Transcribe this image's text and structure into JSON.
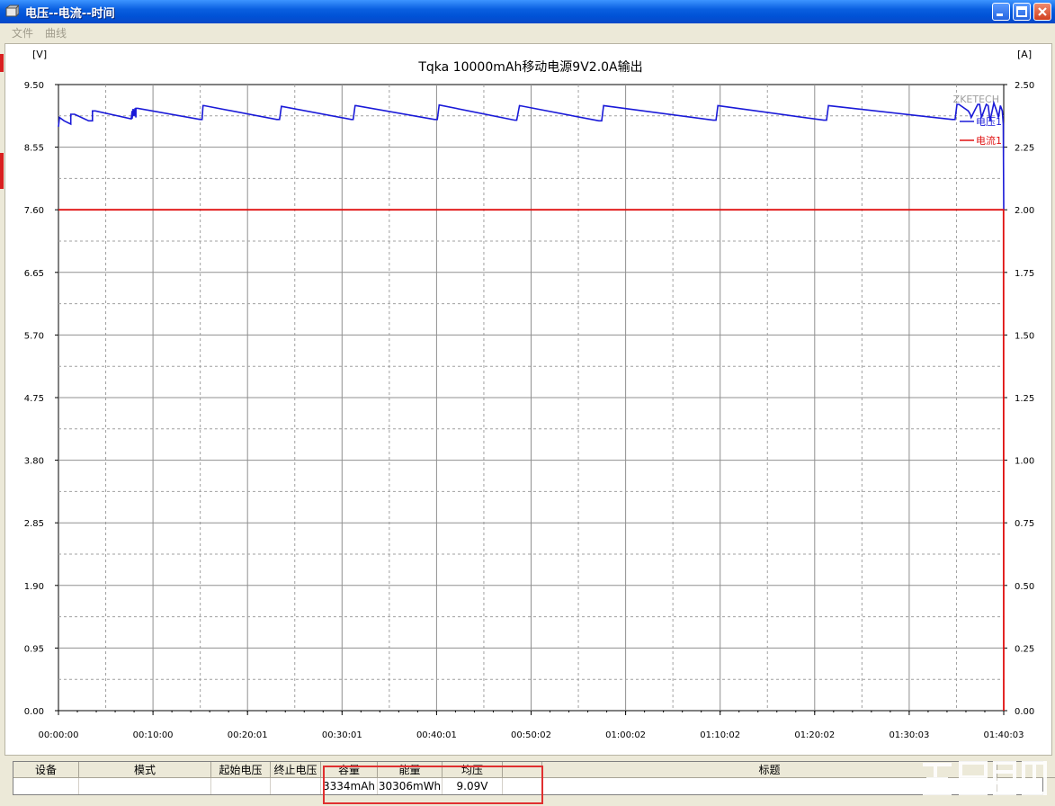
{
  "window": {
    "title": "电压--电流--时间"
  },
  "menu": [
    {
      "label": "文件"
    },
    {
      "label": "曲线"
    }
  ],
  "chart_data": {
    "type": "line",
    "title": "Tqka 10000mAh移动电源9V2.0A输出",
    "watermark_text": "ZKETECH",
    "left_unit": "[V]",
    "right_unit": "[A]",
    "x_ticks": [
      "00:00:00",
      "00:10:00",
      "00:20:01",
      "00:30:01",
      "00:40:01",
      "00:50:02",
      "01:00:02",
      "01:10:02",
      "01:20:02",
      "01:30:03",
      "01:40:03"
    ],
    "y_left_ticks": [
      "0.00",
      "0.95",
      "1.90",
      "2.85",
      "3.80",
      "4.75",
      "5.70",
      "6.65",
      "7.60",
      "8.55",
      "9.50"
    ],
    "y_right_ticks": [
      "0.00",
      "0.25",
      "0.50",
      "0.75",
      "1.00",
      "1.25",
      "1.50",
      "1.75",
      "2.00",
      "2.25",
      "2.50"
    ],
    "ylim_left": [
      0,
      9.5
    ],
    "ylim_right": [
      0,
      2.5
    ],
    "xlim_minutes": [
      0,
      100.05
    ],
    "grid": true,
    "legend_position": "top-right",
    "colors": {
      "voltage": "#1a1ad8",
      "current": "#e01010"
    },
    "series": [
      {
        "name": "电压1",
        "axis": "left",
        "x_minutes": [
          0.0,
          0.1,
          0.6,
          1.3,
          1.3,
          1.7,
          3.2,
          3.6,
          3.6,
          3.9,
          7.7,
          7.8,
          7.8,
          7.9,
          8.0,
          8.1,
          8.2,
          8.2,
          8.4,
          15.0,
          15.2,
          15.3,
          15.4,
          23.1,
          23.4,
          23.6,
          31.0,
          31.2,
          31.4,
          31.5,
          39.8,
          40.1,
          40.3,
          48.3,
          48.5,
          48.8,
          57.2,
          57.5,
          57.7,
          69.3,
          69.6,
          69.8,
          81.0,
          81.3,
          81.5,
          94.6,
          94.9,
          95.1,
          95.3,
          96.3,
          96.5,
          96.6,
          97.3,
          97.5,
          97.7,
          98.2,
          98.4,
          98.6,
          99.0,
          99.3,
          99.5,
          99.7,
          99.9,
          100.0,
          100.05
        ],
        "y_volts": [
          8.86,
          9.0,
          8.95,
          8.9,
          9.05,
          9.05,
          8.95,
          8.95,
          9.1,
          9.1,
          8.98,
          9.1,
          8.98,
          9.13,
          9.02,
          9.14,
          9.0,
          9.14,
          9.14,
          8.97,
          8.97,
          9.18,
          9.18,
          8.97,
          8.97,
          9.17,
          8.97,
          8.97,
          9.18,
          9.18,
          8.97,
          8.97,
          9.19,
          8.96,
          8.96,
          9.18,
          8.95,
          8.95,
          9.18,
          8.96,
          8.96,
          9.18,
          8.96,
          8.96,
          9.18,
          8.97,
          8.97,
          9.2,
          9.2,
          9.1,
          9.05,
          9.0,
          9.2,
          9.2,
          9.0,
          9.2,
          9.18,
          8.95,
          9.22,
          9.1,
          9.0,
          9.18,
          9.1,
          8.9,
          7.6
        ]
      },
      {
        "name": "电流1",
        "axis": "right",
        "x_minutes": [
          0.0,
          100.0,
          100.03,
          100.05
        ],
        "y_amps": [
          2.0,
          2.0,
          2.0,
          0.0
        ]
      }
    ]
  },
  "table": {
    "headers": [
      {
        "label": "设备"
      },
      {
        "label": "模式"
      },
      {
        "label": "起始电压"
      },
      {
        "label": "终止电压"
      },
      {
        "label": "容量"
      },
      {
        "label": "能量"
      },
      {
        "label": "均压"
      },
      {
        "label": ""
      },
      {
        "label": "标题"
      },
      {
        "label": ""
      }
    ],
    "row": [
      "",
      "",
      "",
      "",
      "3334mAh",
      "30306mWh",
      "9.09V",
      "",
      "",
      ""
    ]
  }
}
